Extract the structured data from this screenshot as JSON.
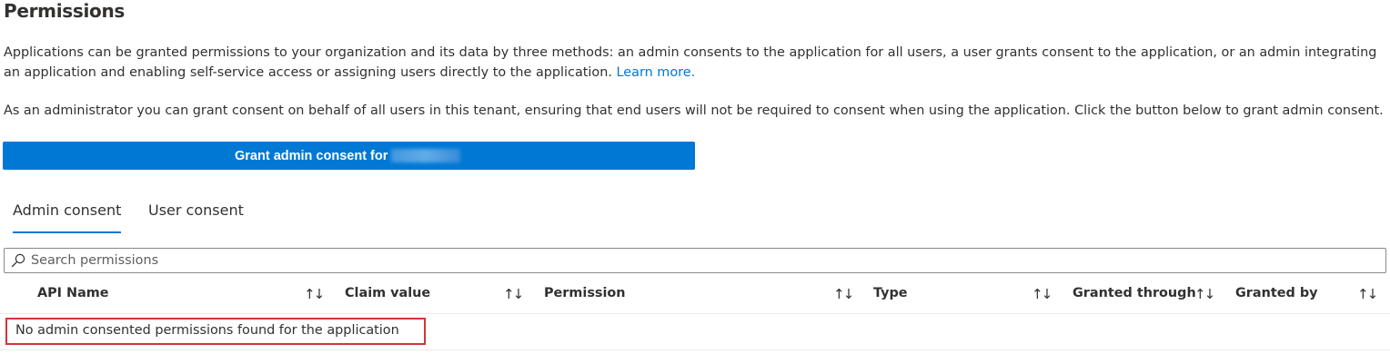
{
  "page": {
    "title": "Permissions"
  },
  "intro": {
    "text": "Applications can be granted permissions to your organization and its data by three methods: an admin consents to the application for all users, a user grants consent to the application, or an admin integrating an application and enabling self-service access or assigning users directly to the application.",
    "link_label": "Learn more."
  },
  "admin_info": {
    "text": "As an administrator you can grant consent on behalf of all users in this tenant, ensuring that end users will not be required to consent when using the application. Click the button below to grant admin consent."
  },
  "grant_button": {
    "label": "Grant admin consent for",
    "color": "#0078d4"
  },
  "tabs": [
    {
      "label": "Admin consent",
      "selected": true
    },
    {
      "label": "User consent",
      "selected": false
    }
  ],
  "search": {
    "placeholder": "Search permissions",
    "value": ""
  },
  "table": {
    "columns": [
      {
        "label": "API Name",
        "sort_icon": "sort-arrows-icon"
      },
      {
        "label": "Claim value",
        "sort_icon": "sort-arrows-icon"
      },
      {
        "label": "Permission",
        "sort_icon": "sort-arrows-icon"
      },
      {
        "label": "Type",
        "sort_icon": "sort-arrows-icon"
      },
      {
        "label": "Granted through",
        "sort_icon": "sort-arrows-icon"
      },
      {
        "label": "Granted by",
        "sort_icon": "sort-arrows-icon"
      }
    ],
    "empty_message": "No admin consented permissions found for the application",
    "highlight_color": "#d13438"
  },
  "icons": {
    "sort": "↑↓"
  }
}
